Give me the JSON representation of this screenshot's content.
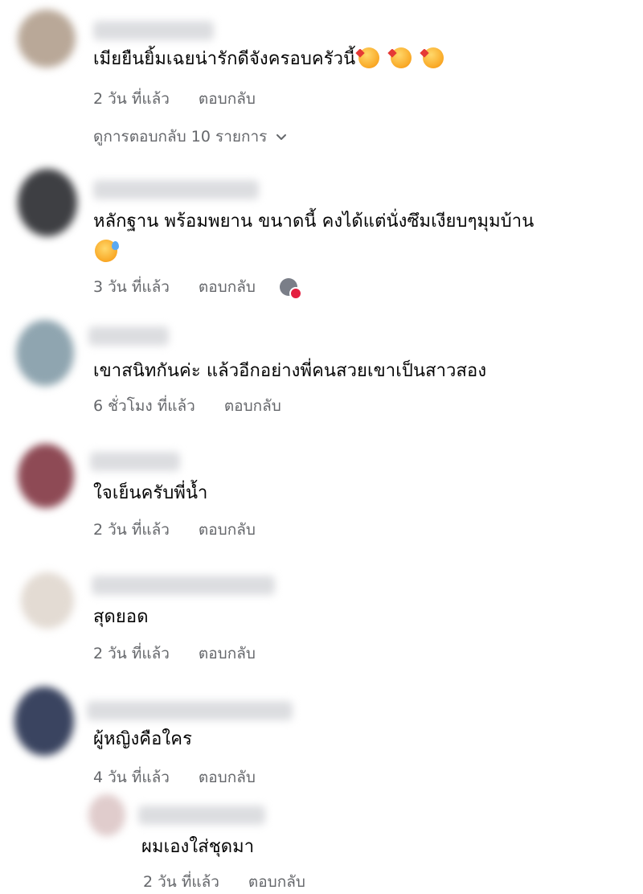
{
  "colors": {
    "meta_text": "#65676b",
    "body_text": "#050505",
    "notification_badge": "#e41e3f"
  },
  "comments": [
    {
      "text": "เมียยืนยิ้มเฉยน่ารักดีจังครอบครัวนี้",
      "emoji": [
        "smiling-face-with-hearts",
        "smiling-face-with-hearts",
        "smiling-face-with-hearts"
      ],
      "time": "2 วัน ที่แล้ว",
      "reply": "ตอบกลับ",
      "view_replies": "ดูการตอบกลับ 10 รายการ"
    },
    {
      "text_line1": "หลักฐาน พร้อมพยาน ขนาดนี้ คงได้แต่นั่งซึมเงียบๆมุมบ้าน",
      "emoji": "smiling-face-with-sweat",
      "time": "3 วัน ที่แล้ว",
      "reply": "ตอบกลับ"
    },
    {
      "text": "เขาสนิทกันค่ะ แล้วอีกอย่างพี่คนสวยเขาเป็นสาวสอง",
      "time": "6 ชั่วโมง ที่แล้ว",
      "reply": "ตอบกลับ"
    },
    {
      "text": "ใจเย็นครับพี่น้ำ",
      "time": "2 วัน ที่แล้ว",
      "reply": "ตอบกลับ"
    },
    {
      "text": "สุดยอด",
      "time": "2 วัน ที่แล้ว",
      "reply": "ตอบกลับ"
    },
    {
      "text": "ผู้หญิงคือใคร",
      "time": "4 วัน ที่แล้ว",
      "reply": "ตอบกลับ"
    }
  ],
  "reply": {
    "text": "ผมเองใส่ชุดมา",
    "time": "2 วัน ที่แล้ว",
    "reply": "ตอบกลับ"
  }
}
